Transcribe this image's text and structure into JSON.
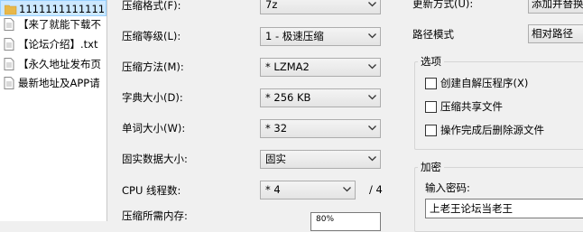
{
  "files": [
    {
      "name": "1111111111111",
      "icon": "folder-icon",
      "selected": true
    },
    {
      "name": "【来了就能下载不",
      "icon": "text-file-icon"
    },
    {
      "name": "【论坛介绍】.txt",
      "icon": "text-file-icon"
    },
    {
      "name": "【永久地址发布页",
      "icon": "text-file-icon"
    },
    {
      "name": "最新地址及APP请",
      "icon": "text-file-icon"
    }
  ],
  "settings": {
    "format": {
      "label": "压缩格式(F):",
      "value": "7z"
    },
    "level": {
      "label": "压缩等级(L):",
      "value": "1 - 极速压缩"
    },
    "method": {
      "label": "压缩方法(M):",
      "value": "* LZMA2"
    },
    "dict": {
      "label": "字典大小(D):",
      "value": "* 256 KB"
    },
    "word": {
      "label": "单词大小(W):",
      "value": "* 32"
    },
    "solid": {
      "label": "固实数据大小:",
      "value": "固实"
    },
    "cpu": {
      "label": "CPU 线程数:",
      "value": "* 4",
      "total": "/ 4"
    },
    "memory": {
      "label": "压缩所需内存:",
      "value": "80%"
    }
  },
  "right": {
    "update_label": "更新方式(U):",
    "update_value": "添加并替换",
    "path_label": "路径模式",
    "path_value": "相对路径"
  },
  "options": {
    "title": "选项",
    "items": [
      {
        "label": "创建自解压程序(X)",
        "checked": false
      },
      {
        "label": "压缩共享文件",
        "checked": false
      },
      {
        "label": "操作完成后删除源文件",
        "checked": false
      }
    ]
  },
  "encryption": {
    "title": "加密",
    "password_label": "输入密码:",
    "password_value": "上老王论坛当老王"
  }
}
